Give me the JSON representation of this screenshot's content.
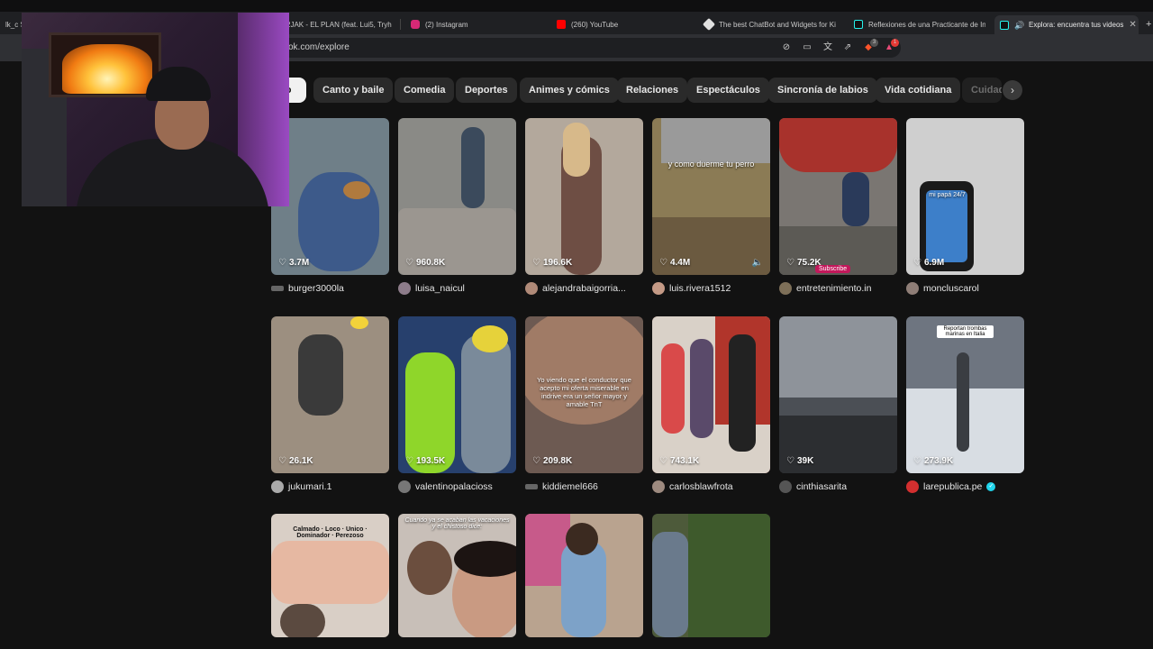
{
  "browser": {
    "tabs": [
      {
        "title": "lk_c Str",
        "favicon_color": "#8a8a8a"
      },
      {
        "title": "2JAK - EL PLAN (feat. Lui5, Tryh",
        "favicon_color": "#e53935"
      },
      {
        "title": "(2) Instagram",
        "favicon_color": "#d62976"
      },
      {
        "title": "(260) YouTube",
        "favicon_color": "#ff0000"
      },
      {
        "title": "The best ChatBot and Widgets for Ki",
        "favicon_color": "#e0e0e0"
      },
      {
        "title": "Reflexiones de una Practicante de Ins",
        "favicon_color": "#25f4ee"
      },
      {
        "title": "Explora: encuentra tus videos",
        "favicon_color": "#25f4ee"
      }
    ],
    "url": "ok.com/explore",
    "shield_badge": "3",
    "alert_badge": "1"
  },
  "categories": {
    "items": [
      "do",
      "Canto y baile",
      "Comedia",
      "Deportes",
      "Animes y cómics",
      "Relaciones",
      "Espectáculos",
      "Sincronía de labios",
      "Vida cotidiana",
      "Cuidado"
    ],
    "active_index": 0,
    "next_icon": "chevron-right-icon"
  },
  "videos": [
    {
      "likes": "3.7M",
      "author": "burger3000la",
      "overlay": "",
      "bg": "#6f7f88"
    },
    {
      "likes": "960.8K",
      "author": "luisa_naicul",
      "overlay": "",
      "bg": "#8a8a86"
    },
    {
      "likes": "196.6K",
      "author": "alejandrabaigorria...",
      "overlay": "",
      "bg": "#b3a89c"
    },
    {
      "likes": "4.4M",
      "author": "luis.rivera1512",
      "overlay": "y como duerme tu perro",
      "bg": "#8b7b55"
    },
    {
      "likes": "75.2K",
      "author": "entretenimiento.in",
      "overlay": "",
      "bg": "#7a7672"
    },
    {
      "likes": "6.9M",
      "author": "moncluscarol",
      "overlay": "mi papá 24/7",
      "bg": "#cfcfcf"
    },
    {
      "likes": "26.1K",
      "author": "jukumari.1",
      "overlay": "",
      "bg": "#9c8f80"
    },
    {
      "likes": "193.5K",
      "author": "valentinopalacioss",
      "overlay": "",
      "bg": "#27406d"
    },
    {
      "likes": "209.8K",
      "author": "kiddiemel666",
      "overlay": "Yo viendo que el conductor que acepto mi oferta miserable en indrive era un señor mayor y amable TnT",
      "bg": "#6d5a52"
    },
    {
      "likes": "743.1K",
      "author": "carlosblawfrota",
      "overlay": "",
      "bg": "#a3473c"
    },
    {
      "likes": "39K",
      "author": "cinthiasarita",
      "overlay": "",
      "bg": "#4b4f55"
    },
    {
      "likes": "273.9K",
      "author": "larepublica.pe",
      "overlay": "Reportan trombas marinas en Italia",
      "bg": "#6e7580",
      "verified": true
    },
    {
      "likes": "",
      "author": "",
      "overlay": "Calmado · Loco · Unico · Dominador · Perezoso",
      "bg": "#d9cfc6"
    },
    {
      "likes": "",
      "author": "",
      "overlay": "Cuando ya se acaban las vacaciones y el chistoso dice:",
      "bg": "#c8bfb8"
    },
    {
      "likes": "",
      "author": "",
      "overlay": "",
      "bg": "#b9a38f"
    },
    {
      "likes": "",
      "author": "",
      "overlay": "",
      "bg": "#4d5a3a"
    }
  ],
  "overlays": {
    "subscribe_tag": "Subscribe"
  },
  "colors": {
    "page_bg": "#121212",
    "chip_bg": "#2a2a2a",
    "chip_active_bg": "#f1f1f1",
    "verified": "#20d5ec"
  }
}
